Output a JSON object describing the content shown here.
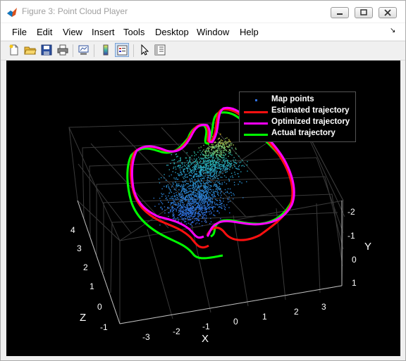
{
  "window": {
    "title": "Figure 3: Point Cloud Player"
  },
  "menu": {
    "items": [
      "File",
      "Edit",
      "View",
      "Insert",
      "Tools",
      "Desktop",
      "Window",
      "Help"
    ],
    "overflow_icon": "dock-arrow-icon"
  },
  "toolbar": {
    "buttons": [
      "new-figure-icon",
      "open-file-icon",
      "save-icon",
      "print-icon",
      "link-plot-icon",
      "insert-colorbar-icon",
      "insert-legend-icon",
      "edit-plot-icon",
      "property-inspector-icon"
    ]
  },
  "legend": {
    "entries": [
      {
        "label": "Map points",
        "color": "#2f6fe0"
      },
      {
        "label": "Estimated trajectory",
        "color": "#ff1010"
      },
      {
        "label": "Optimized trajectory",
        "color": "#ff00ff"
      },
      {
        "label": "Actual trajectory",
        "color": "#00ff00"
      }
    ]
  },
  "axes": {
    "x_label": "X",
    "y_label": "Y",
    "z_label": "Z",
    "x_ticks": [
      "-3",
      "-2",
      "-1",
      "0",
      "1",
      "2",
      "3"
    ],
    "y_ticks": [
      "-2",
      "-1",
      "0",
      "1"
    ],
    "z_ticks": [
      "4",
      "3",
      "2",
      "1",
      "0",
      "-1"
    ]
  },
  "colors": {
    "background": "#000000",
    "grid": "#3a3a3a",
    "estimated": "#ff1010",
    "optimized": "#ff00ff",
    "actual": "#00ff00"
  }
}
